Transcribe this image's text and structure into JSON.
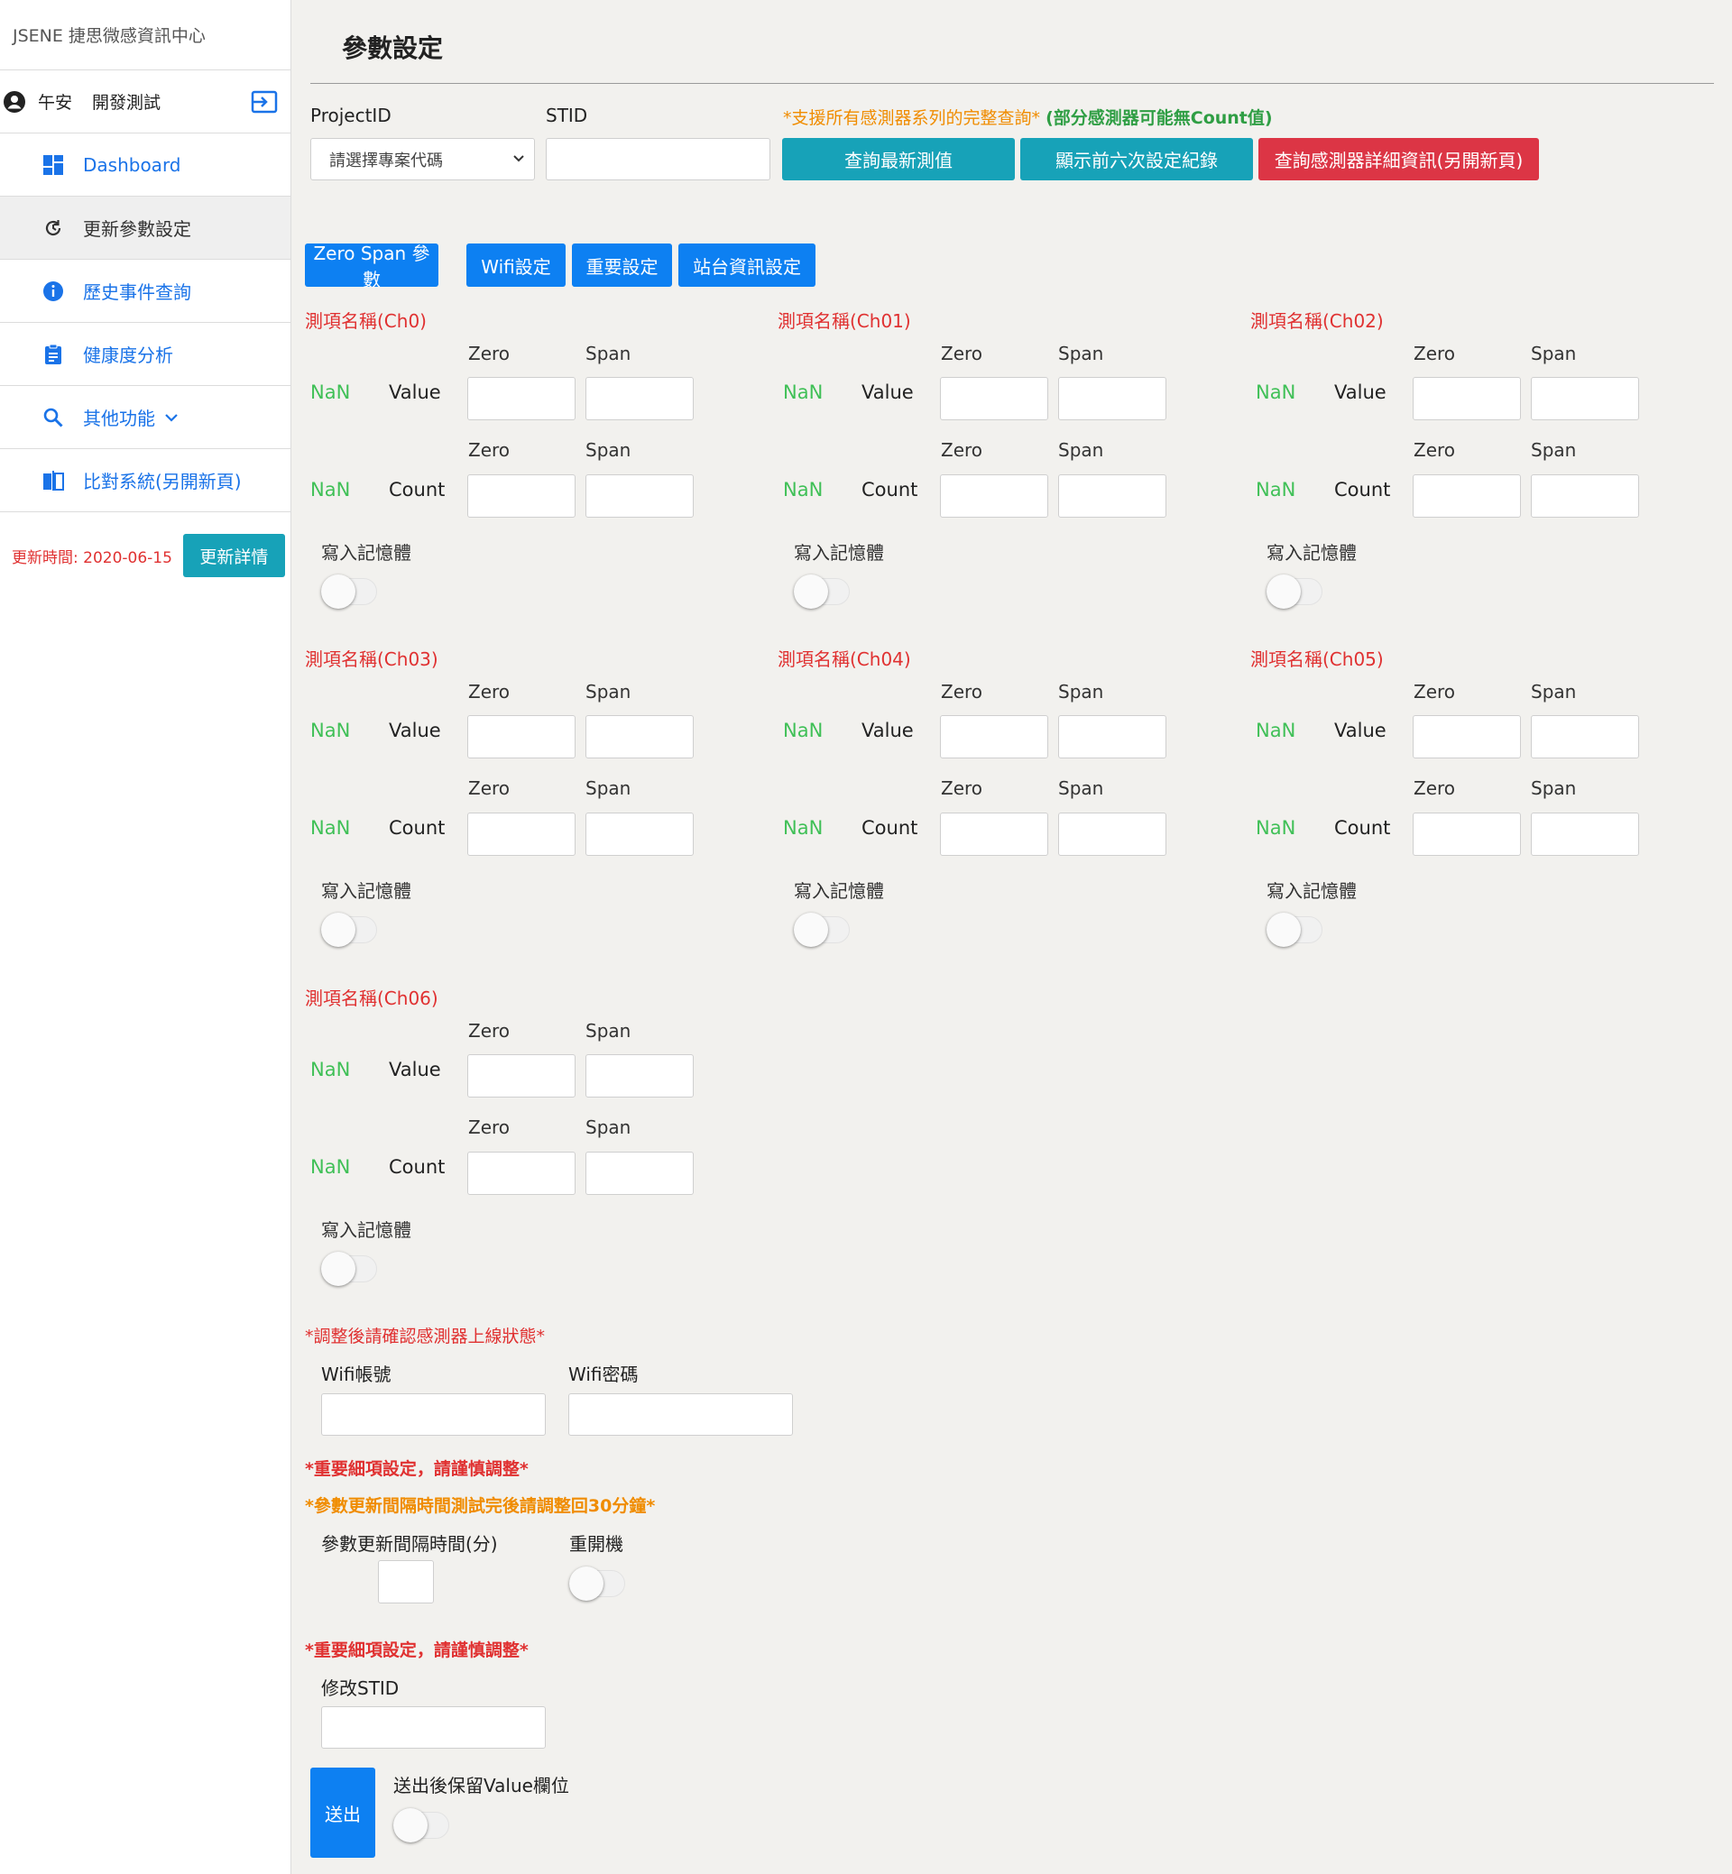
{
  "sidebar": {
    "brand": "JSENE 捷思微感資訊中心",
    "greeting": "午安",
    "username": "開發測試",
    "items": [
      {
        "label": "Dashboard"
      },
      {
        "label": "更新參數設定"
      },
      {
        "label": "歷史事件查詢"
      },
      {
        "label": "健康度分析"
      },
      {
        "label": "其他功能"
      },
      {
        "label": "比對系統(另開新頁)"
      }
    ],
    "update_time": "更新時間: 2020-06-15",
    "update_button": "更新詳情"
  },
  "page": {
    "title": "參數設定",
    "project_label": "ProjectID",
    "project_selected": "請選擇專案代碼",
    "stid_label": "STID",
    "stid_value": "",
    "support_note": "*支援所有感測器系列的完整查詢*",
    "count_note": "(部分感測器可能無Count值)",
    "btn_latest": "查詢最新測值",
    "btn_history": "顯示前六次設定紀錄",
    "btn_detail": "查詢感測器詳細資訊(另開新頁)"
  },
  "tabs": [
    "Zero Span 參數",
    "Wifi設定",
    "重要設定",
    "站台資訊設定"
  ],
  "channel_labels": {
    "zero": "Zero",
    "span": "Span",
    "nan": "NaN",
    "value": "Value",
    "count": "Count",
    "write": "寫入記憶體"
  },
  "channels": [
    {
      "name": "測項名稱(Ch0)"
    },
    {
      "name": "測項名稱(Ch01)"
    },
    {
      "name": "測項名稱(Ch02)"
    },
    {
      "name": "測項名稱(Ch03)"
    },
    {
      "name": "測項名稱(Ch04)"
    },
    {
      "name": "測項名稱(Ch05)"
    },
    {
      "name": "測項名稱(Ch06)"
    }
  ],
  "wifi": {
    "note": "*調整後請確認感測器上線狀態*",
    "account_label": "Wifi帳號",
    "password_label": "Wifi密碼"
  },
  "important": {
    "note1": "*重要細項設定，請謹慎調整*",
    "note2": "*參數更新間隔時間測試完後請調整回30分鐘*",
    "interval_label": "參數更新間隔時間(分)",
    "reboot_label": "重開機"
  },
  "station": {
    "note": "*重要細項設定，請謹慎調整*",
    "stid_label": "修改STID"
  },
  "submit": {
    "button": "送出",
    "keep_label": "送出後保留Value欄位"
  },
  "colors": {
    "teal": "#17a2b8",
    "red": "#dc3545",
    "blue": "#0d80f2",
    "nan_green": "#40c057",
    "channel_red": "#e03131",
    "note_orange": "#f08c00"
  }
}
